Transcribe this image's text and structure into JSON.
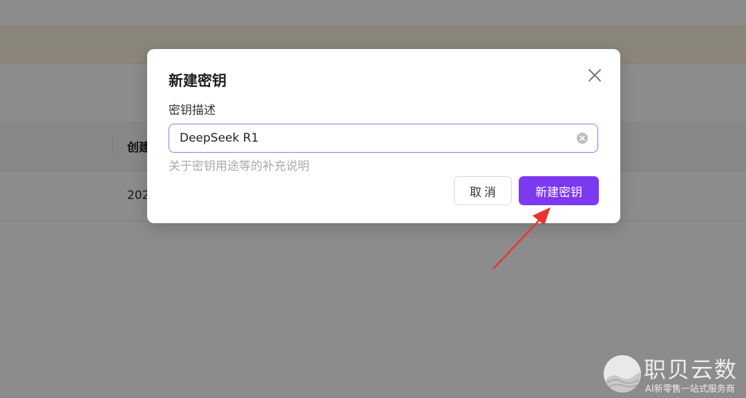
{
  "background": {
    "table_header_col": "创建",
    "row_cell": "202"
  },
  "modal": {
    "title": "新建密钥",
    "field_label": "密钥描述",
    "input_value": "DeepSeek R1",
    "helper_text": "关于密钥用途等的补充说明",
    "cancel_label": "取消",
    "submit_label": "新建密钥"
  },
  "watermark": {
    "title": "职贝云数",
    "subtitle": "AI新零售一站式服务商"
  },
  "colors": {
    "accent": "#7c39f0",
    "focus_border": "#a26bff",
    "arrow": "#e8362d"
  },
  "icons": {
    "close": "close-icon",
    "clear": "clear-input-icon",
    "annotation": "arrow-annotation"
  }
}
